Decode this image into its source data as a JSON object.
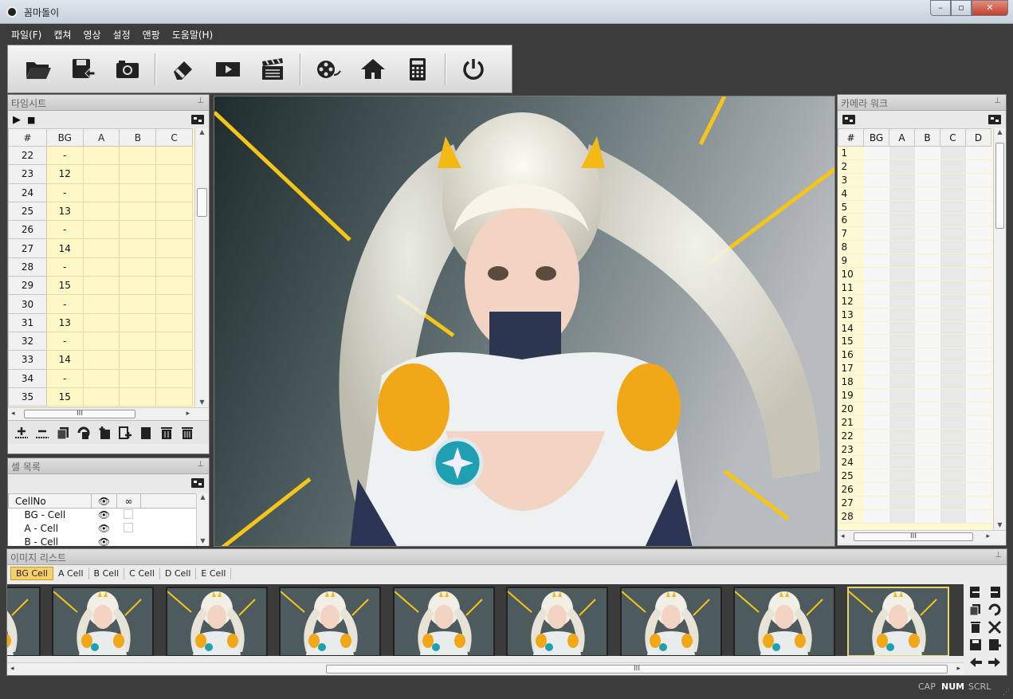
{
  "window": {
    "title": "꼼마돌이"
  },
  "menu": [
    "파일(F)",
    "캡쳐",
    "영상",
    "설정",
    "앤팡",
    "도움말(H)"
  ],
  "toolbar": {
    "buttons": [
      {
        "name": "open-folder-icon"
      },
      {
        "name": "save-export-icon"
      },
      {
        "name": "camera-icon"
      },
      {
        "name": "eraser-icon"
      },
      {
        "name": "video-icon"
      },
      {
        "name": "clapper-icon"
      },
      {
        "name": "film-reel-icon"
      },
      {
        "name": "home-icon"
      },
      {
        "name": "calculator-icon"
      },
      {
        "name": "power-icon"
      }
    ]
  },
  "timesheet": {
    "title": "타임시트",
    "columns": [
      "#",
      "BG",
      "A",
      "B",
      "C"
    ],
    "rows": [
      {
        "n": "22",
        "bg": "-"
      },
      {
        "n": "23",
        "bg": "12"
      },
      {
        "n": "24",
        "bg": "-"
      },
      {
        "n": "25",
        "bg": "13"
      },
      {
        "n": "26",
        "bg": "-"
      },
      {
        "n": "27",
        "bg": "14"
      },
      {
        "n": "28",
        "bg": "-"
      },
      {
        "n": "29",
        "bg": "15"
      },
      {
        "n": "30",
        "bg": "-"
      },
      {
        "n": "31",
        "bg": "13"
      },
      {
        "n": "32",
        "bg": "-"
      },
      {
        "n": "33",
        "bg": "14"
      },
      {
        "n": "34",
        "bg": "-"
      },
      {
        "n": "35",
        "bg": "15"
      }
    ],
    "scroll_mark": "III"
  },
  "cell_list": {
    "title": "셀 목록",
    "header": "CellNo",
    "items": [
      "BG  - Cell",
      "A  - Cell",
      "B  - Cell"
    ]
  },
  "camera_work": {
    "title": "카메라 워크",
    "columns": [
      "#",
      "BG",
      "A",
      "B",
      "C",
      "D"
    ],
    "rows": [
      "1",
      "2",
      "3",
      "4",
      "5",
      "6",
      "7",
      "8",
      "9",
      "10",
      "11",
      "12",
      "13",
      "14",
      "15",
      "16",
      "17",
      "18",
      "19",
      "20",
      "21",
      "22",
      "23",
      "24",
      "25",
      "26",
      "27",
      "28"
    ],
    "scroll_mark": "III"
  },
  "image_list": {
    "title": "이미지 리스트",
    "tabs": [
      "BG Cell",
      "A Cell",
      "B Cell",
      "C Cell",
      "D Cell",
      "E Cell"
    ],
    "active_tab": 0,
    "thumbnail_count": 9,
    "selected_thumbnail": 8,
    "scroll_mark": "III"
  },
  "status": {
    "cap": "CAP",
    "num": "NUM",
    "scrl": "SCRL"
  },
  "colors": {
    "accent": "#f5c518",
    "sheet": "#fdf8c6",
    "dark": "#3c3c3c"
  }
}
